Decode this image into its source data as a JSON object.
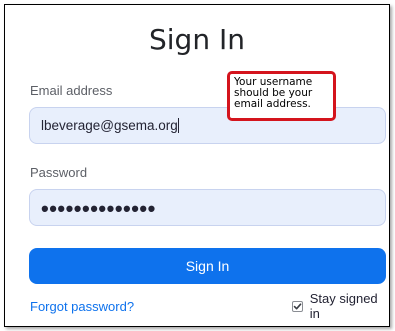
{
  "title": "Sign In",
  "email": {
    "label": "Email address",
    "value": "lbeverage@gsema.org"
  },
  "password": {
    "label": "Password",
    "masked_value": "••••••••••••••"
  },
  "signin_button": {
    "label": "Sign In"
  },
  "forgot_password": {
    "label": "Forgot password?"
  },
  "stay_signed_in": {
    "label": "Stay signed in",
    "checked": true
  },
  "annotation": {
    "lines": [
      "Your username",
      "should be your",
      "email address."
    ]
  },
  "colors": {
    "accent": "#0e72ed",
    "field_background": "#e8effc",
    "annotation_border": "#d4141d"
  },
  "icons": {
    "checkbox": "checkmark-icon"
  }
}
